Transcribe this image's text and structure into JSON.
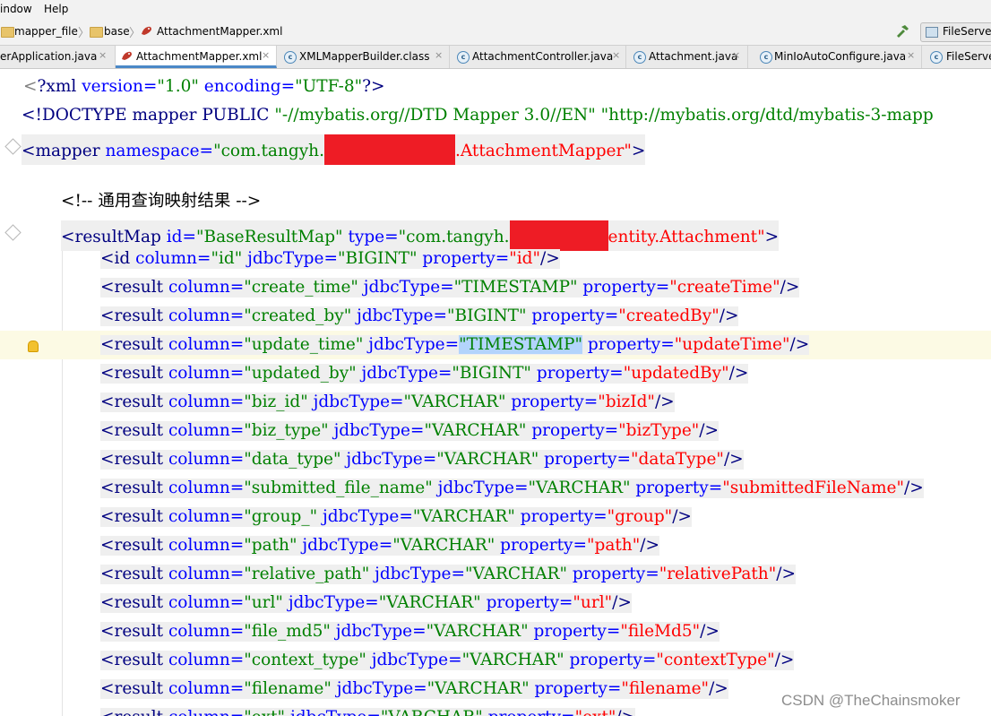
{
  "menu": {
    "items": [
      "indow",
      "Help"
    ]
  },
  "breadcrumb": {
    "items": [
      "mapper_file",
      "base",
      "AttachmentMapper.xml"
    ]
  },
  "run_config": {
    "label": "FileServer"
  },
  "tabs": [
    {
      "label": "erApplication.java",
      "close": "×"
    },
    {
      "label": "AttachmentMapper.xml",
      "close": "×",
      "active": true
    },
    {
      "label": "XMLMapperBuilder.class",
      "close": "×"
    },
    {
      "label": "AttachmentController.java",
      "close": "×"
    },
    {
      "label": "Attachment.java",
      "close": "×"
    },
    {
      "label": "MinIoAutoConfigure.java",
      "close": "×"
    },
    {
      "label": "FileServe",
      "close": ""
    }
  ],
  "code": {
    "line1": {
      "p1": "<",
      "p2": "?xml",
      "p3": " version=",
      "p4": "\"1.0\"",
      "p5": " encoding=",
      "p6": "\"UTF-8\"",
      "p7": "?>"
    },
    "line2": {
      "p1": "<!DOCTYPE mapper PUBLIC ",
      "p2": "\"-//mybatis.org//DTD Mapper 3.0//EN\"",
      "p3": " ",
      "p4": "\"http://mybatis.org/dtd/mybatis-3-mapp"
    },
    "line3": {
      "p1": "<mapper",
      "p2": " namespace=",
      "p3": "\"com.tangyh.",
      "p4": ".AttachmentMapper\"",
      "p5": ">"
    },
    "line4": {
      "comment": "<!-- 通用查询映射结果 -->"
    },
    "line5": {
      "p1": "<resultMap",
      "p2": " id=",
      "p3": "\"BaseResultMap\"",
      "p4": " type=",
      "p5": "\"com.tangyh.",
      "p6": "entity.Attachment\"",
      "p7": ">"
    },
    "rows": [
      {
        "tag": "<id",
        "a1": " column=",
        "v1": "\"id\"",
        "a2": " jdbcType=",
        "v2": "\"BIGINT\"",
        "a3": " property=",
        "v3": "\"id\"",
        "end": "/>"
      },
      {
        "tag": "<result",
        "a1": " column=",
        "v1": "\"create_time\"",
        "a2": " jdbcType=",
        "v2": "\"TIMESTAMP\"",
        "a3": " property=",
        "v3": "\"createTime\"",
        "end": "/>"
      },
      {
        "tag": "<result",
        "a1": " column=",
        "v1": "\"created_by\"",
        "a2": " jdbcType=",
        "v2": "\"BIGINT\"",
        "a3": " property=",
        "v3": "\"createdBy\"",
        "end": "/>"
      },
      {
        "tag": "<result",
        "a1": " column=",
        "v1": "\"update_time\"",
        "a2": " jdbcType=",
        "v2": "\"TIMESTAMP\"",
        "a3": " property=",
        "v3": "\"updateTime\"",
        "end": "/>"
      },
      {
        "tag": "<result",
        "a1": " column=",
        "v1": "\"updated_by\"",
        "a2": " jdbcType=",
        "v2": "\"BIGINT\"",
        "a3": " property=",
        "v3": "\"updatedBy\"",
        "end": "/>"
      },
      {
        "tag": "<result",
        "a1": " column=",
        "v1": "\"biz_id\"",
        "a2": " jdbcType=",
        "v2": "\"VARCHAR\"",
        "a3": " property=",
        "v3": "\"bizId\"",
        "end": "/>"
      },
      {
        "tag": "<result",
        "a1": " column=",
        "v1": "\"biz_type\"",
        "a2": " jdbcType=",
        "v2": "\"VARCHAR\"",
        "a3": " property=",
        "v3": "\"bizType\"",
        "end": "/>"
      },
      {
        "tag": "<result",
        "a1": " column=",
        "v1": "\"data_type\"",
        "a2": " jdbcType=",
        "v2": "\"VARCHAR\"",
        "a3": " property=",
        "v3": "\"dataType\"",
        "end": "/>"
      },
      {
        "tag": "<result",
        "a1": " column=",
        "v1": "\"submitted_file_name\"",
        "a2": " jdbcType=",
        "v2": "\"VARCHAR\"",
        "a3": " property=",
        "v3": "\"submittedFileName\"",
        "end": "/>"
      },
      {
        "tag": "<result",
        "a1": " column=",
        "v1": "\"group_\"",
        "a2": " jdbcType=",
        "v2": "\"VARCHAR\"",
        "a3": " property=",
        "v3": "\"group\"",
        "end": "/>"
      },
      {
        "tag": "<result",
        "a1": " column=",
        "v1": "\"path\"",
        "a2": " jdbcType=",
        "v2": "\"VARCHAR\"",
        "a3": " property=",
        "v3": "\"path\"",
        "end": "/>"
      },
      {
        "tag": "<result",
        "a1": " column=",
        "v1": "\"relative_path\"",
        "a2": " jdbcType=",
        "v2": "\"VARCHAR\"",
        "a3": " property=",
        "v3": "\"relativePath\"",
        "end": "/>"
      },
      {
        "tag": "<result",
        "a1": " column=",
        "v1": "\"url\"",
        "a2": " jdbcType=",
        "v2": "\"VARCHAR\"",
        "a3": " property=",
        "v3": "\"url\"",
        "end": "/>"
      },
      {
        "tag": "<result",
        "a1": " column=",
        "v1": "\"file_md5\"",
        "a2": " jdbcType=",
        "v2": "\"VARCHAR\"",
        "a3": " property=",
        "v3": "\"fileMd5\"",
        "end": "/>"
      },
      {
        "tag": "<result",
        "a1": " column=",
        "v1": "\"context_type\"",
        "a2": " jdbcType=",
        "v2": "\"VARCHAR\"",
        "a3": " property=",
        "v3": "\"contextType\"",
        "end": "/>"
      },
      {
        "tag": "<result",
        "a1": " column=",
        "v1": "\"filename\"",
        "a2": " jdbcType=",
        "v2": "\"VARCHAR\"",
        "a3": " property=",
        "v3": "\"filename\"",
        "end": "/>"
      },
      {
        "tag": "<result",
        "a1": " column=",
        "v1": "\"ext\"",
        "a2": " jdbcType=",
        "v2": "\"VARCHAR\"",
        "a3": " property=",
        "v3": "\"ext\"",
        "end": "/>"
      }
    ]
  },
  "watermark": "CSDN @TheChainsmoker",
  "colors": {
    "tag": "#000080",
    "attr": "#0000ff",
    "value": "#008000",
    "value_red": "#ff0000",
    "comment": "#808080",
    "redaction": "#ee1c25",
    "tab_active": "#4a88c7"
  }
}
